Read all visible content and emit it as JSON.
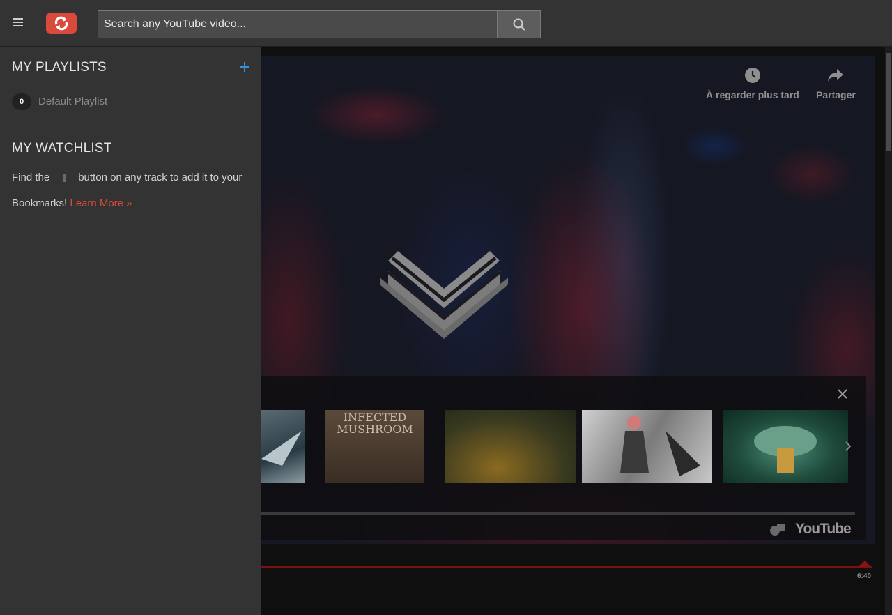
{
  "header": {
    "search_placeholder": "Search any YouTube video...",
    "accent_color": "#d9493c"
  },
  "sidebar": {
    "playlists_title": "MY PLAYLISTS",
    "playlists": [
      {
        "count": "0",
        "name": "Default Playlist"
      }
    ],
    "watchlist_title": "MY WATCHLIST",
    "watchlist_text_before": "Find the",
    "watchlist_text_after": "button on any track to add it to your Bookmarks!",
    "learn_more": "Learn More »"
  },
  "player": {
    "watch_later": "À regarder plus tard",
    "share": "Partager",
    "youtube_label": "YouTube",
    "duration": "6:40",
    "progress": 0.98,
    "thumbnails": [
      {
        "icon": "thumbnail-1"
      },
      {
        "title": "INFECTED MUSHROOM"
      },
      {
        "icon": "thumbnail-3"
      },
      {
        "icon": "thumbnail-4"
      },
      {
        "icon": "thumbnail-5"
      }
    ]
  }
}
